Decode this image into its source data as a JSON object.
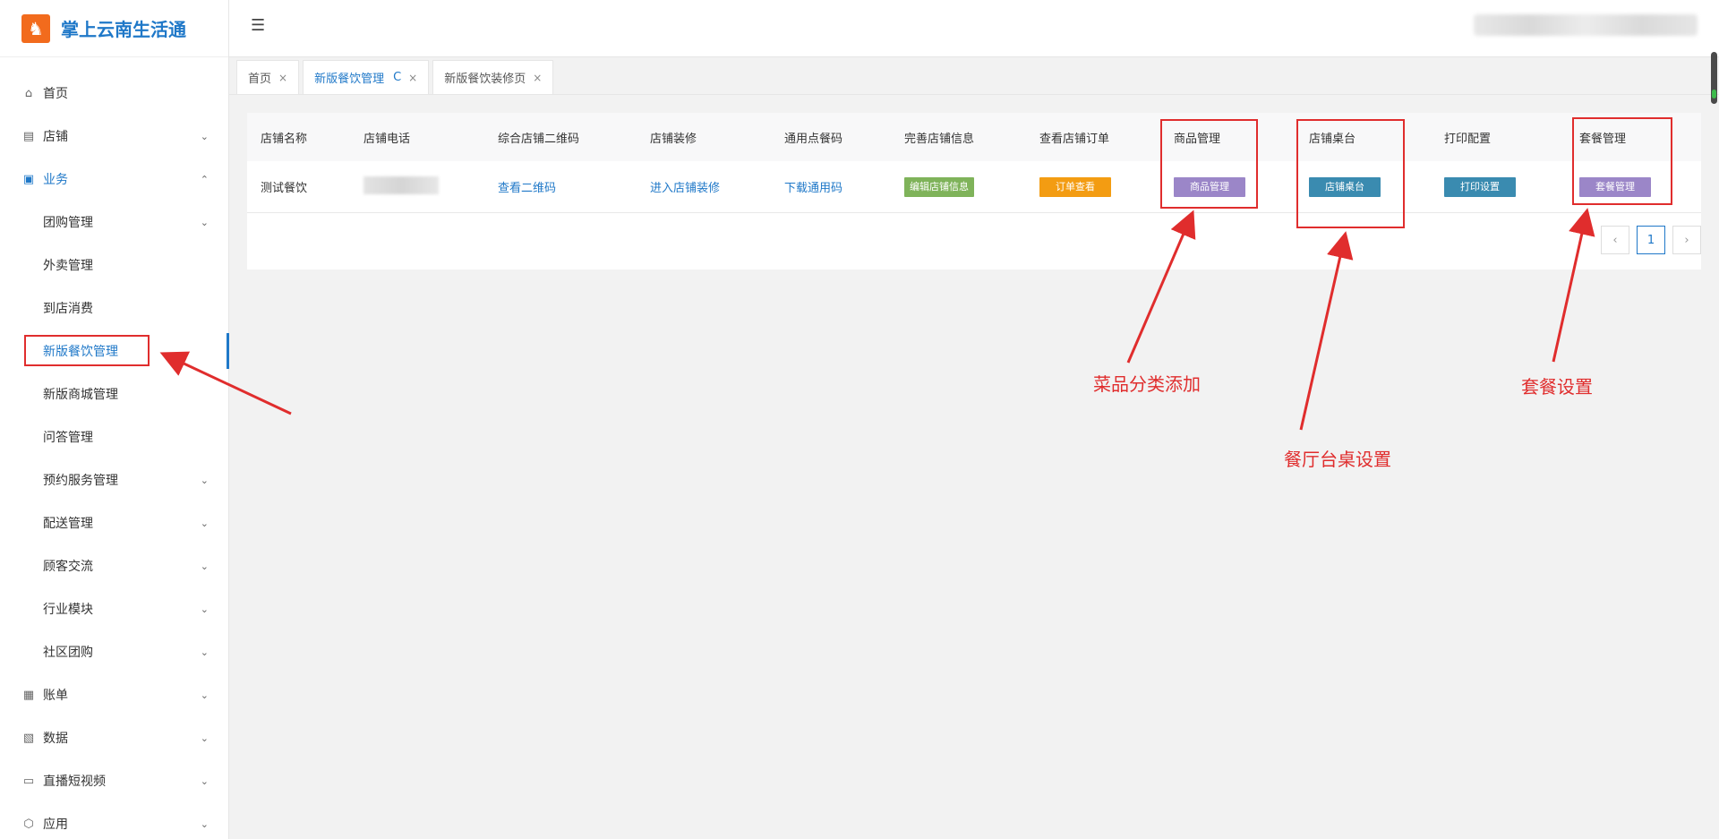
{
  "brand": {
    "title": "掌上云南生活通",
    "logo_glyph": "♞"
  },
  "sidebar": {
    "items": [
      {
        "label": "首页",
        "icon": "home-icon",
        "glyph": "⌂",
        "sub": false,
        "chev": ""
      },
      {
        "label": "店铺",
        "icon": "shop-icon",
        "glyph": "▤",
        "sub": false,
        "chev": "⌄"
      },
      {
        "label": "业务",
        "icon": "business-icon",
        "glyph": "▣",
        "sub": false,
        "chev": "⌃"
      },
      {
        "label": "团购管理",
        "icon": "",
        "glyph": "",
        "sub": true,
        "chev": "⌄"
      },
      {
        "label": "外卖管理",
        "icon": "",
        "glyph": "",
        "sub": true,
        "chev": ""
      },
      {
        "label": "到店消费",
        "icon": "",
        "glyph": "",
        "sub": true,
        "chev": ""
      },
      {
        "label": "新版餐饮管理",
        "icon": "",
        "glyph": "",
        "sub": true,
        "chev": ""
      },
      {
        "label": "新版商城管理",
        "icon": "",
        "glyph": "",
        "sub": true,
        "chev": ""
      },
      {
        "label": "问答管理",
        "icon": "",
        "glyph": "",
        "sub": true,
        "chev": ""
      },
      {
        "label": "预约服务管理",
        "icon": "",
        "glyph": "",
        "sub": true,
        "chev": "⌄"
      },
      {
        "label": "配送管理",
        "icon": "",
        "glyph": "",
        "sub": true,
        "chev": "⌄"
      },
      {
        "label": "顾客交流",
        "icon": "",
        "glyph": "",
        "sub": true,
        "chev": "⌄"
      },
      {
        "label": "行业模块",
        "icon": "",
        "glyph": "",
        "sub": true,
        "chev": "⌄"
      },
      {
        "label": "社区团购",
        "icon": "",
        "glyph": "",
        "sub": true,
        "chev": "⌄"
      },
      {
        "label": "账单",
        "icon": "bill-icon",
        "glyph": "▦",
        "sub": false,
        "chev": "⌄"
      },
      {
        "label": "数据",
        "icon": "data-icon",
        "glyph": "▧",
        "sub": false,
        "chev": "⌄"
      },
      {
        "label": "直播短视频",
        "icon": "live-icon",
        "glyph": "▭",
        "sub": false,
        "chev": "⌄"
      },
      {
        "label": "应用",
        "icon": "app-icon",
        "glyph": "⬡",
        "sub": false,
        "chev": "⌄"
      }
    ]
  },
  "tabs": [
    {
      "label": "首页",
      "close": "×"
    },
    {
      "label": "新版餐饮管理",
      "refresh": "C",
      "close": "×"
    },
    {
      "label": "新版餐饮装修页",
      "close": "×"
    }
  ],
  "table": {
    "headers": [
      "店铺名称",
      "店铺电话",
      "综合店铺二维码",
      "店铺装修",
      "通用点餐码",
      "完善店铺信息",
      "查看店铺订单",
      "商品管理",
      "店铺桌台",
      "打印配置",
      "套餐管理"
    ],
    "row": {
      "name": "测试餐饮",
      "qrcode": "查看二维码",
      "decorate": "进入店铺装修",
      "download": "下载通用码",
      "edit_info": "编辑店铺信息",
      "orders": "订单查看",
      "goods": "商品管理",
      "tables": "店铺桌台",
      "print": "打印设置",
      "combo": "套餐管理"
    }
  },
  "colors": {
    "green": "#7fb35a",
    "orange": "#f39c12",
    "purple": "#9b86c8",
    "teal": "#3a8bb0",
    "brand_blue": "#1f78c8",
    "annotation_red": "#e02d2d"
  },
  "pagination": {
    "prev": "‹",
    "current": "1",
    "next": "›"
  },
  "annotations": {
    "goods": "菜品分类添加",
    "tables": "餐厅台桌设置",
    "combo": "套餐设置"
  },
  "header": {
    "toggle_glyph": "☰"
  }
}
